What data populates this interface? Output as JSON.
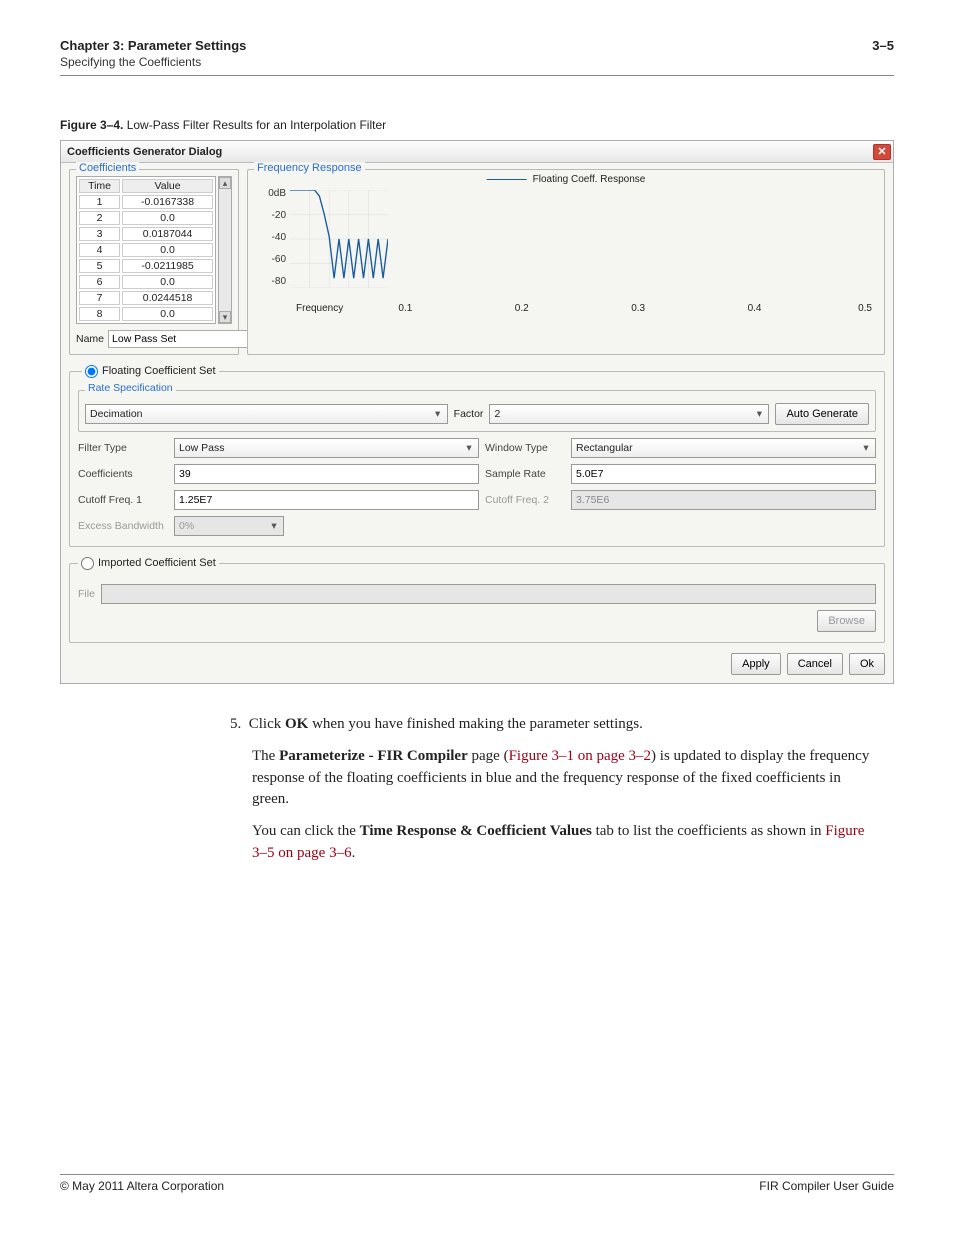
{
  "header": {
    "chapter": "Chapter 3: Parameter Settings",
    "sub": "Specifying the Coefficients",
    "page_num": "3–5"
  },
  "figure_caption": {
    "bold": "Figure 3–4.",
    "rest": "  Low-Pass Filter Results for an Interpolation Filter"
  },
  "dialog": {
    "title": "Coefficients Generator Dialog",
    "close": "✕",
    "coef_panel": {
      "label": "Coefficients"
    },
    "freq_panel": {
      "label": "Frequency Response"
    },
    "table_headers": {
      "c0": "Time",
      "c1": "Value"
    },
    "rows": [
      {
        "t": "1",
        "v": "-0.0167338"
      },
      {
        "t": "2",
        "v": "0.0"
      },
      {
        "t": "3",
        "v": "0.0187044"
      },
      {
        "t": "4",
        "v": "0.0"
      },
      {
        "t": "5",
        "v": "-0.0211985"
      },
      {
        "t": "6",
        "v": "0.0"
      },
      {
        "t": "7",
        "v": "0.0244518"
      },
      {
        "t": "8",
        "v": "0.0"
      }
    ],
    "name_label": "Name",
    "name_value": "Low Pass Set",
    "legend": "Floating Coeff. Response",
    "ylabels": [
      "0dB",
      "-20",
      "-40",
      "-60",
      "-80"
    ],
    "xlabelaxis": "Frequency",
    "xticks": [
      "0.1",
      "0.2",
      "0.3",
      "0.4",
      "0.5"
    ],
    "floating_radio": "Floating Coefficient Set",
    "rate_spec_label": "Rate Specification",
    "rate_spec_value": "Decimation",
    "factor_label": "Factor",
    "factor_value": "2",
    "auto_gen": "Auto Generate",
    "filter_type_label": "Filter Type",
    "filter_type_value": "Low Pass",
    "window_type_label": "Window Type",
    "window_type_value": "Rectangular",
    "coef_label": "Coefficients",
    "coef_value": "39",
    "sample_rate_label": "Sample Rate",
    "sample_rate_value": "5.0E7",
    "cutoff1_label": "Cutoff Freq. 1",
    "cutoff1_value": "1.25E7",
    "cutoff2_label": "Cutoff Freq. 2",
    "cutoff2_value": "3.75E6",
    "excess_bw_label": "Excess Bandwidth",
    "excess_bw_value": "0%",
    "imported_radio": "Imported Coefficient Set",
    "file_label": "File",
    "browse": "Browse",
    "apply": "Apply",
    "cancel": "Cancel",
    "ok": "Ok"
  },
  "body": {
    "step_no": "5.",
    "step_text_a": "Click ",
    "step_bold": "OK",
    "step_text_b": " when you have finished making the parameter settings.",
    "p1_a": "The ",
    "p1_bold": "Parameterize - FIR Compiler",
    "p1_b": " page (",
    "p1_link": "Figure 3–1 on page 3–2",
    "p1_c": ") is updated to display the frequency response of the floating coefficients in blue and the frequency response of the fixed coefficients in green.",
    "p2_a": "You can click the ",
    "p2_bold": "Time Response & Coefficient Values",
    "p2_b": " tab to list the coefficients as shown in ",
    "p2_link": "Figure 3–5 on page 3–6",
    "p2_c": "."
  },
  "footer": {
    "left": "© May 2011   Altera Corporation",
    "right": "FIR Compiler User Guide"
  },
  "chart_data": {
    "type": "line",
    "title": "Floating Coeff. Response",
    "xlabel": "Frequency",
    "ylabel": "dB",
    "x": [
      0,
      0.05,
      0.1,
      0.125,
      0.15,
      0.175,
      0.2,
      0.225,
      0.25,
      0.275,
      0.3,
      0.325,
      0.35,
      0.375,
      0.4,
      0.425,
      0.45,
      0.475,
      0.5
    ],
    "values": [
      0,
      0,
      0,
      0,
      -5,
      -20,
      -38,
      -72,
      -40,
      -72,
      -40,
      -72,
      -40,
      -72,
      -40,
      -72,
      -40,
      -72,
      -40
    ],
    "xlim": [
      0,
      0.5
    ],
    "ylim": [
      -80,
      0
    ]
  }
}
